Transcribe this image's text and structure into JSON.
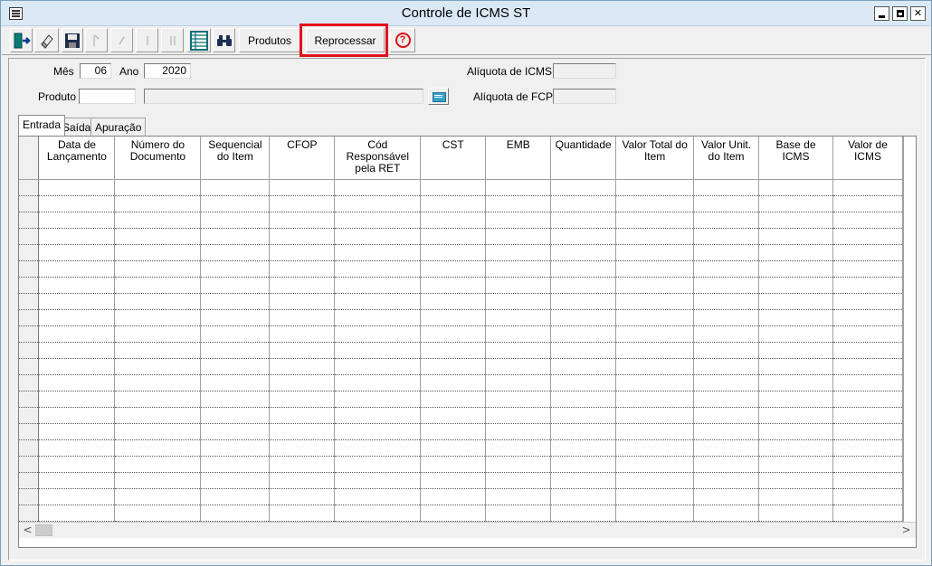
{
  "window": {
    "title": "Controle de ICMS ST"
  },
  "toolbar": {
    "produtos_label": "Produtos",
    "reprocessar_label": "Reprocessar",
    "help_glyph": "?"
  },
  "form": {
    "mes_label": "Mês",
    "mes_value": "06",
    "ano_label": "Ano",
    "ano_value": "2020",
    "produto_label": "Produto",
    "produto_code": "",
    "produto_desc": "",
    "aliquota_icms_label": "Alíquota de ICMS",
    "aliquota_icms_value": "",
    "aliquota_fcp_label": "Alíquota de FCP",
    "aliquota_fcp_value": ""
  },
  "tabs": [
    "Entrada",
    "Saída",
    "Apuração"
  ],
  "grid": {
    "columns": [
      "Data de Lançamento",
      "Número do Documento",
      "Sequencial do Item",
      "CFOP",
      "Cód Responsável pela RET",
      "CST",
      "EMB",
      "Quantidade",
      "Valor Total do Item",
      "Valor Unit. do Item",
      "Base de ICMS",
      "Valor de ICMS"
    ],
    "empty_rows": 21
  },
  "scrollbar": {
    "left_arrow": "<",
    "right_arrow": ">"
  },
  "colors": {
    "highlight": "#e3101a",
    "titlebar": "#dbe9f7",
    "help": "#dd1111"
  }
}
